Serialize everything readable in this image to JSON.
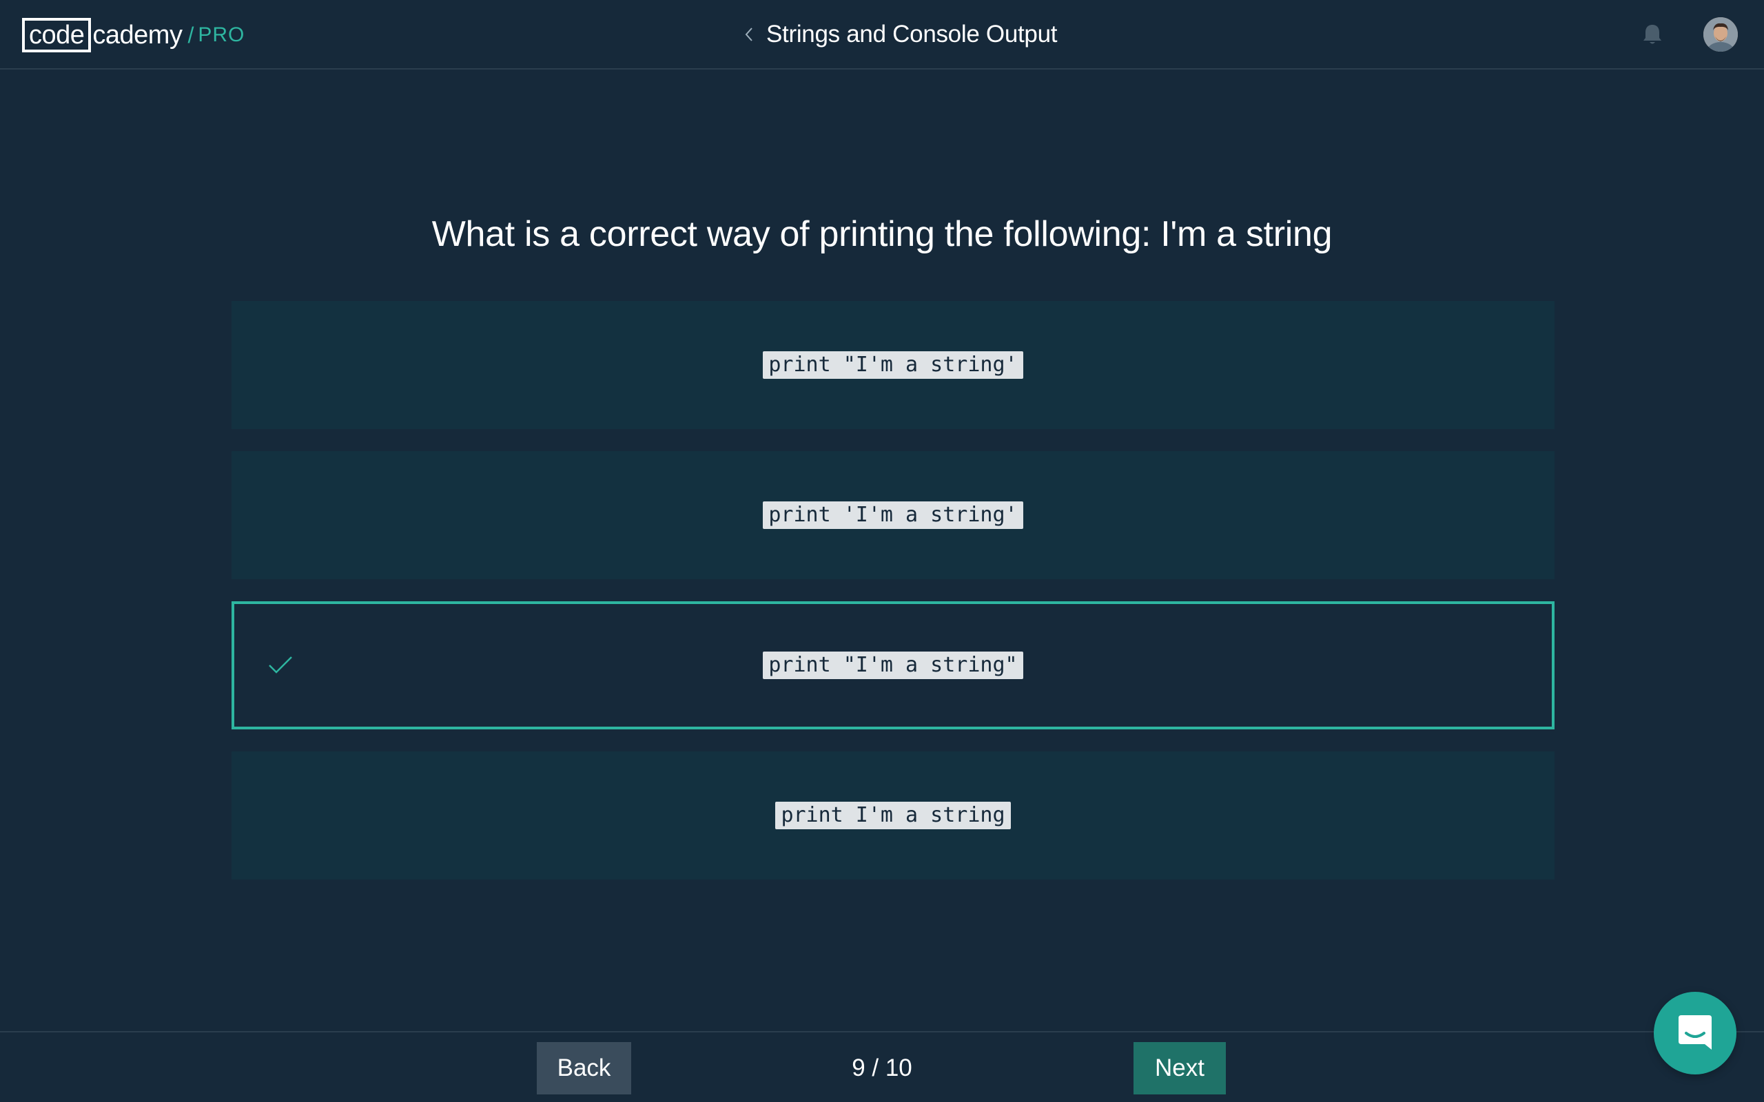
{
  "header": {
    "logo": {
      "code": "code",
      "cademy": "cademy",
      "slash": "/",
      "pro": "PRO"
    },
    "title": "Strings and Console Output",
    "icons": {
      "back": "chevron-left-icon",
      "notifications": "bell-icon",
      "profile": "avatar"
    }
  },
  "quiz": {
    "question": "What is a correct way of printing the following: I'm a string",
    "answers": [
      {
        "code": "print \"I'm a string'",
        "selected": false
      },
      {
        "code": "print 'I'm a string'",
        "selected": false
      },
      {
        "code": "print \"I'm a string\"",
        "selected": true
      },
      {
        "code": "print I'm a string",
        "selected": false
      }
    ]
  },
  "footer": {
    "back_label": "Back",
    "next_label": "Next",
    "progress": "9 / 10"
  },
  "colors": {
    "background": "#16293a",
    "answer_background": "#133140",
    "accent": "#2eb5a0",
    "next_button": "#1f7268",
    "back_button": "#3a4c5c",
    "chat_button": "#1fa596"
  }
}
